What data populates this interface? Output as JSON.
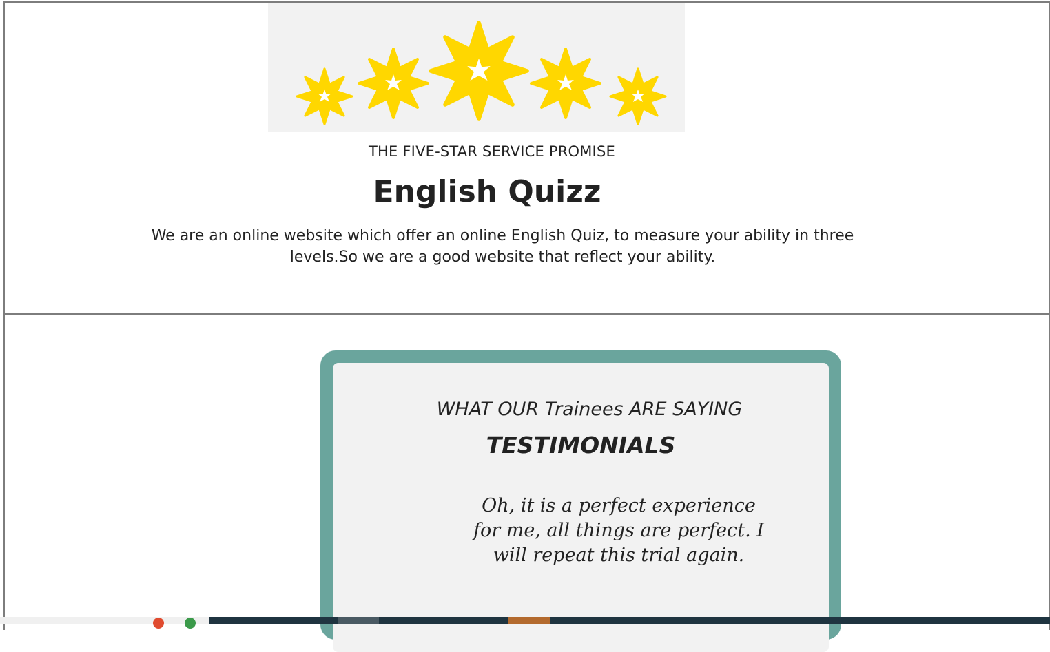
{
  "hero": {
    "promise_text": "THE FIVE-STAR SERVICE PROMISE",
    "title": "English Quizz",
    "intro": "We are an online website which offer an online English Quiz, to measure your ability in three levels.So we are a good website that reflect your ability.",
    "star_color": "#ffd700",
    "star_count": 5
  },
  "testimonials": {
    "kicker": "WHAT OUR Trainees ARE SAYING",
    "heading": "TESTIMONIALS",
    "quote": "Oh, it is a perfect experience for me, all things are perfect. I will repeat this trial again.",
    "frame_color": "#6aa59d",
    "card_color": "#f2f2f2"
  },
  "taskbar": {
    "icons": [
      "red-app-icon",
      "green-app-icon"
    ],
    "highlight_colors": [
      "#4a5a63",
      "#b36a2e"
    ]
  }
}
